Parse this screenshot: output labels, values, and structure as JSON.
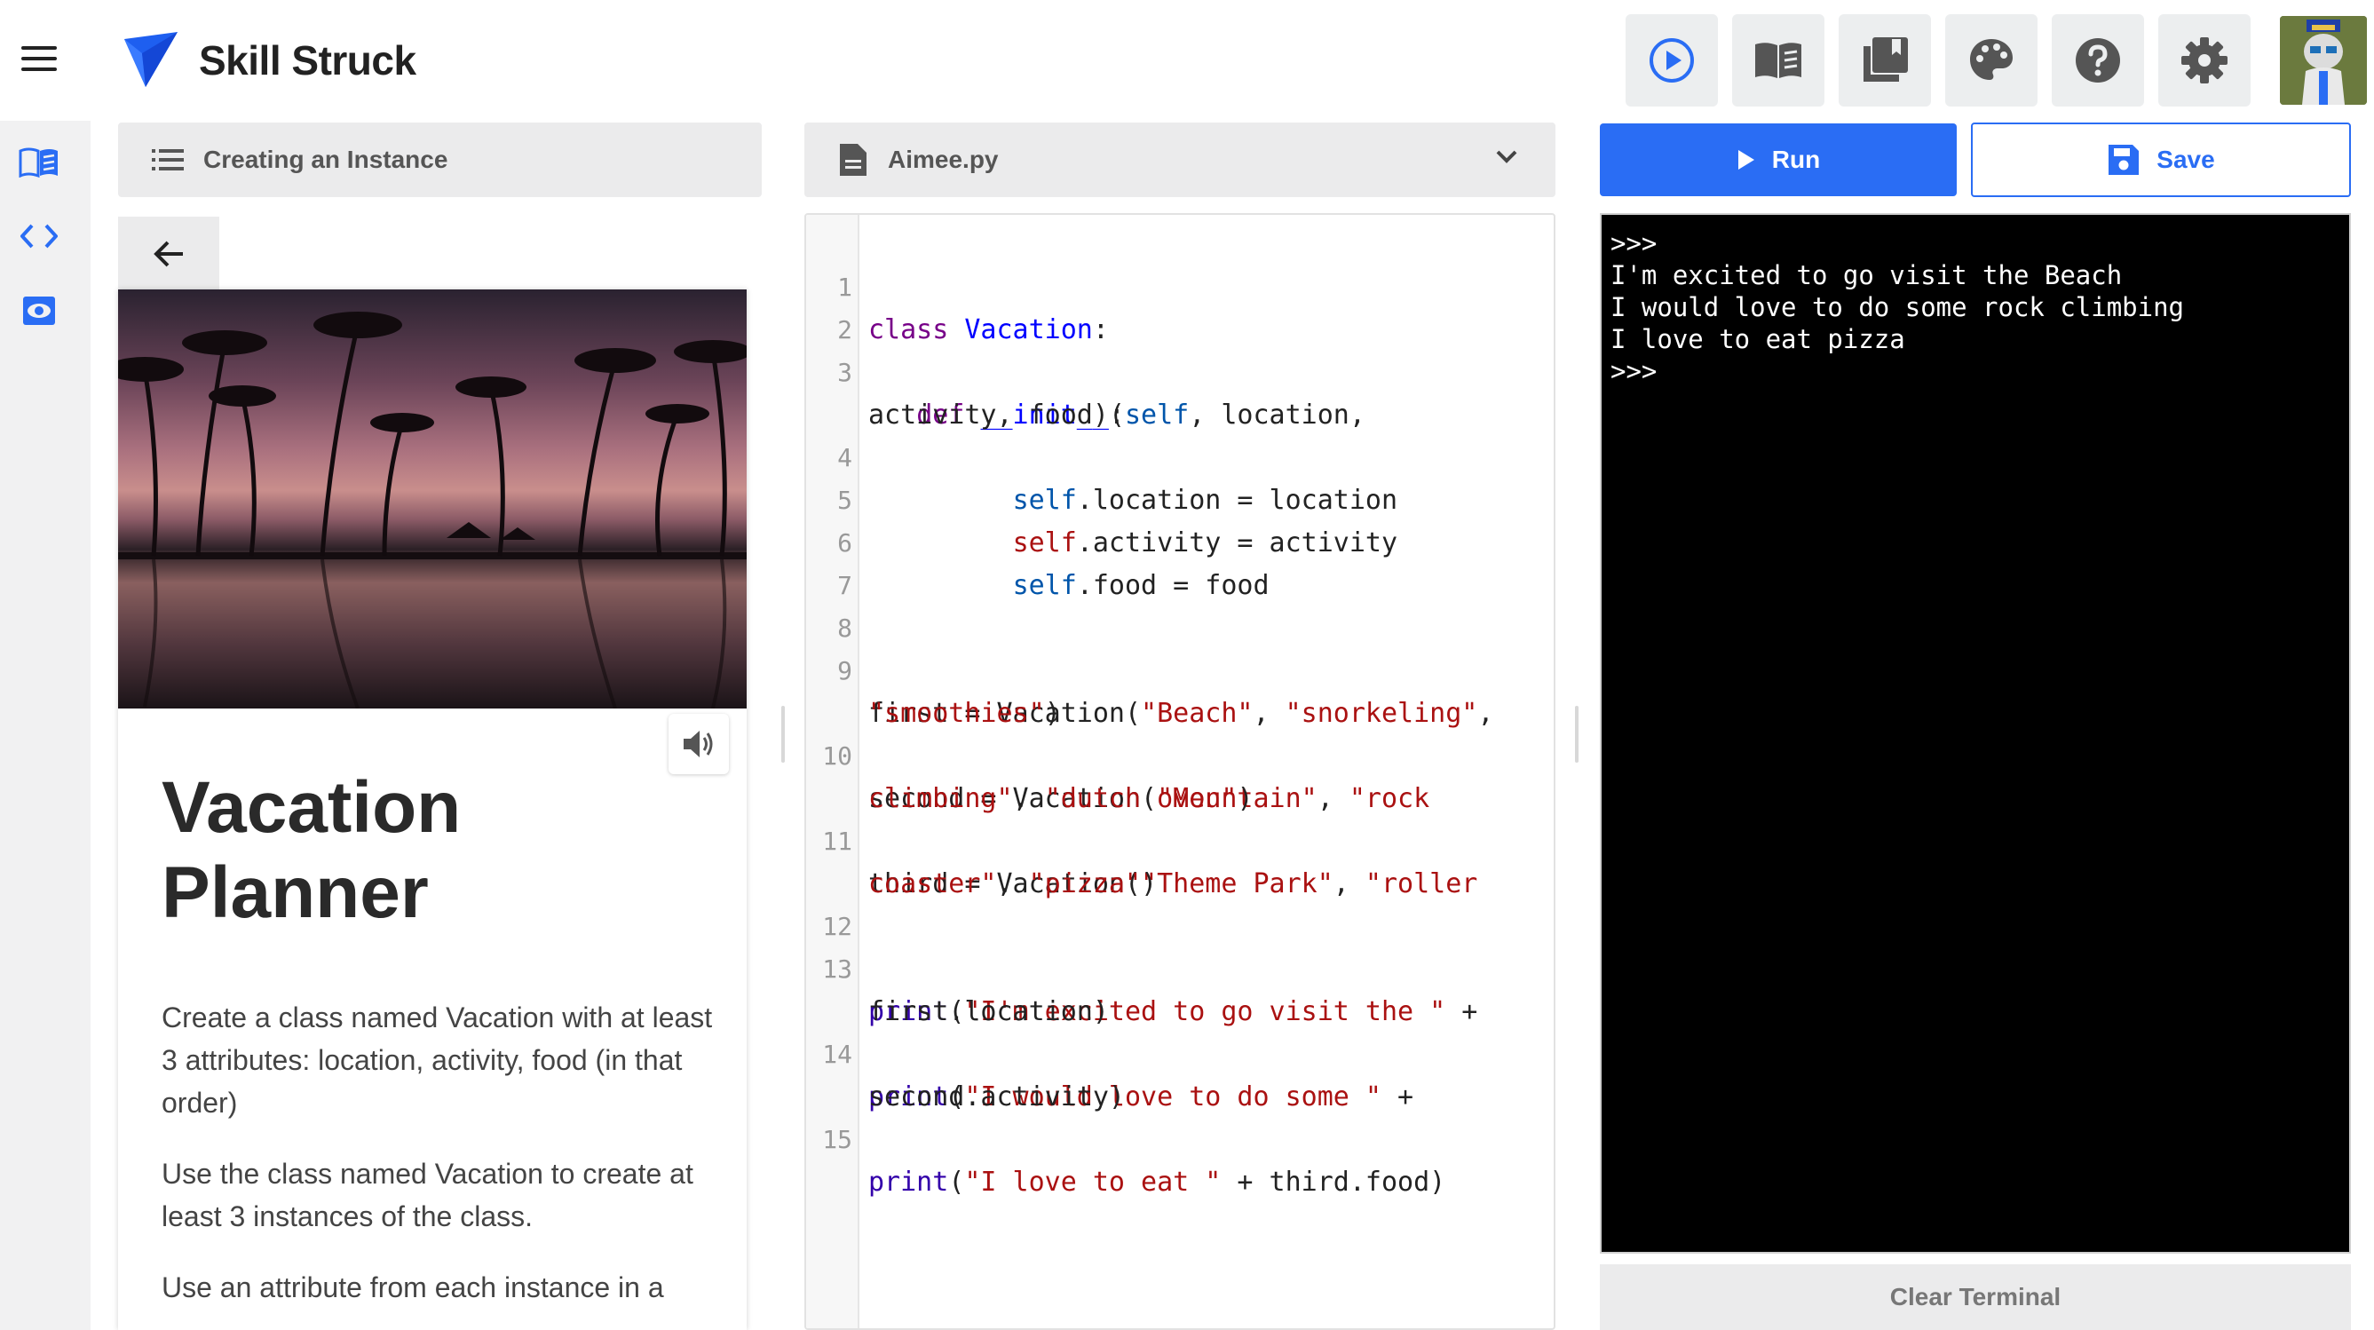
{
  "app": {
    "brand": "Skill Struck",
    "accent_color": "#2a6df4"
  },
  "toolbar": {
    "buttons": [
      {
        "name": "play-icon"
      },
      {
        "name": "book-icon"
      },
      {
        "name": "library-icon"
      },
      {
        "name": "palette-icon"
      },
      {
        "name": "help-icon"
      },
      {
        "name": "settings-icon"
      }
    ]
  },
  "rail": {
    "items": [
      {
        "name": "lesson-book-icon"
      },
      {
        "name": "code-icon"
      },
      {
        "name": "preview-eye-icon"
      }
    ]
  },
  "lesson": {
    "header_label": "Creating an Instance",
    "title": "Vacation Planner",
    "paragraphs": [
      "Create a class named Vacation with at least 3 attributes: location, activity, food (in that order)",
      "Use the class named Vacation to create at least 3 instances of the class.",
      "Use an attribute from each instance in a"
    ]
  },
  "editor": {
    "filename": "Aimee.py"
  },
  "actions": {
    "run_label": "Run",
    "save_label": "Save",
    "clear_terminal_label": "Clear Terminal"
  },
  "terminal": {
    "lines": [
      ">>>",
      "I'm excited to go visit the Beach",
      "I would love to do some rock climbing",
      "I love to eat pizza",
      ">>>"
    ]
  },
  "code": {
    "line_numbers": [
      "1",
      "2",
      "3",
      "4",
      "5",
      "6",
      "7",
      "8",
      "9",
      "10",
      "11",
      "12",
      "13",
      "14",
      "15"
    ],
    "l1_kw": "class",
    "l1_name": "Vacation",
    "l1_rest": ":",
    "l3_kw": "def",
    "l3_fn": "__init__",
    "l3_p1": "(",
    "l3_self": "self",
    "l3_rest": ", location,",
    "l3b": "activity, food):",
    "l4_self": "self",
    "l4_rest": ".location = location",
    "l5_self": "self",
    "l5_rest": ".activity = activity",
    "l6_self": "self",
    "l6_rest": ".food = food",
    "l9_a": "first = Vacation(",
    "l9_s1": "\"Beach\"",
    "l9_c1": ", ",
    "l9_s2": "\"snorkeling\"",
    "l9_c2": ",",
    "l9b_s": "\"smoothies\"",
    "l9b_e": ")",
    "l10_a": "second = Vacation(",
    "l10_s1": "\"Mountain\"",
    "l10_c1": ", ",
    "l10_s2": "\"rock",
    "l10b_s1": "climbing\"",
    "l10b_c": ", ",
    "l10b_s2": "\"dutch oven\"",
    "l10b_e": ")",
    "l11_a": "third = Vacation(",
    "l11_s1": "\"Theme Park\"",
    "l11_c1": ", ",
    "l11_s2": "\"roller",
    "l11b_s1": "coaster\"",
    "l11b_c": ", ",
    "l11b_s2": "\"pizza\"",
    "l11b_e": ")",
    "l13_fn": "print",
    "l13_p": "(",
    "l13_s": "\"I'm excited to go visit the \"",
    "l13_e": " +",
    "l13b": "first.location)",
    "l14_fn": "print",
    "l14_p": "(",
    "l14_s": "\"I would love to do some \"",
    "l14_e": " +",
    "l14b": "second.activity)",
    "l15_fn": "print",
    "l15_p": "(",
    "l15_s": "\"I love to eat \"",
    "l15_e": " + third.food)"
  }
}
